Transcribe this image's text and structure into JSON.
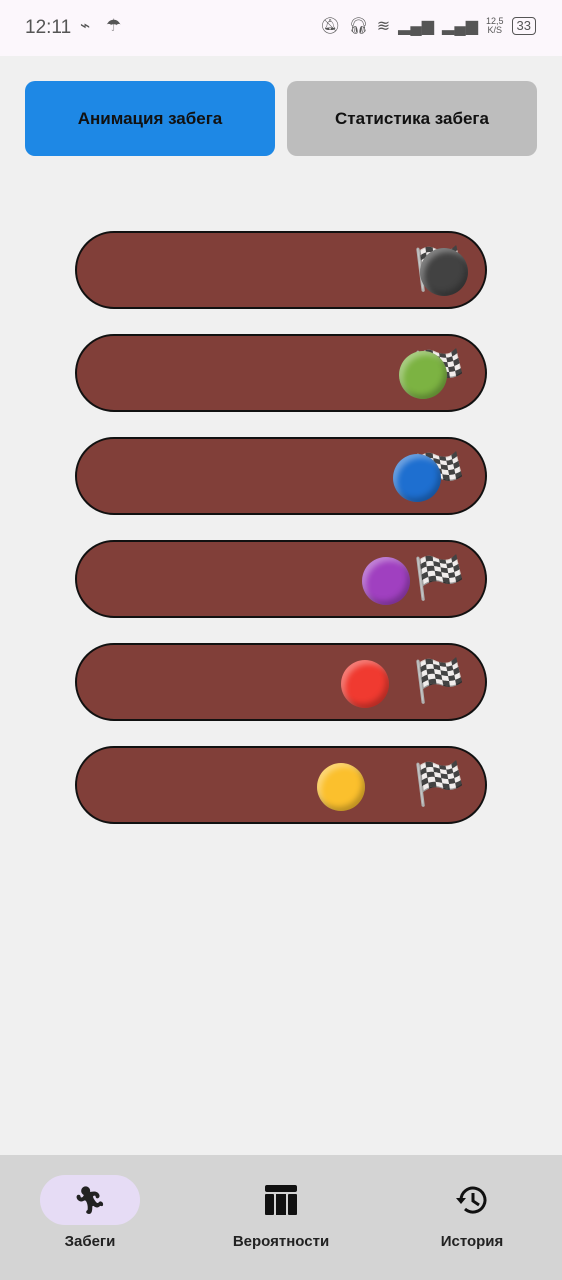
{
  "status_bar": {
    "time": "12:11",
    "speed_value": "12,5",
    "speed_unit": "K/S",
    "battery": "33"
  },
  "tabs": [
    {
      "label": "Анимация забега",
      "active": true,
      "color": "#1e88e5"
    },
    {
      "label": "Статистика забега",
      "active": false,
      "color": "#bdbdbd"
    }
  ],
  "race": {
    "finish_icon": "🏁",
    "runners": [
      {
        "color": "#424242",
        "progress": 1.0
      },
      {
        "color": "#7cb342",
        "progress": 0.94
      },
      {
        "color": "#1e6fd0",
        "progress": 0.92
      },
      {
        "color": "#a040c0",
        "progress": 0.83
      },
      {
        "color": "#f03a30",
        "progress": 0.77
      },
      {
        "color": "#fbc02d",
        "progress": 0.7
      }
    ]
  },
  "nav": [
    {
      "label": "Забеги",
      "icon": "running-icon",
      "active": true
    },
    {
      "label": "Вероятности",
      "icon": "table-icon",
      "active": false
    },
    {
      "label": "История",
      "icon": "history-icon",
      "active": false
    }
  ]
}
